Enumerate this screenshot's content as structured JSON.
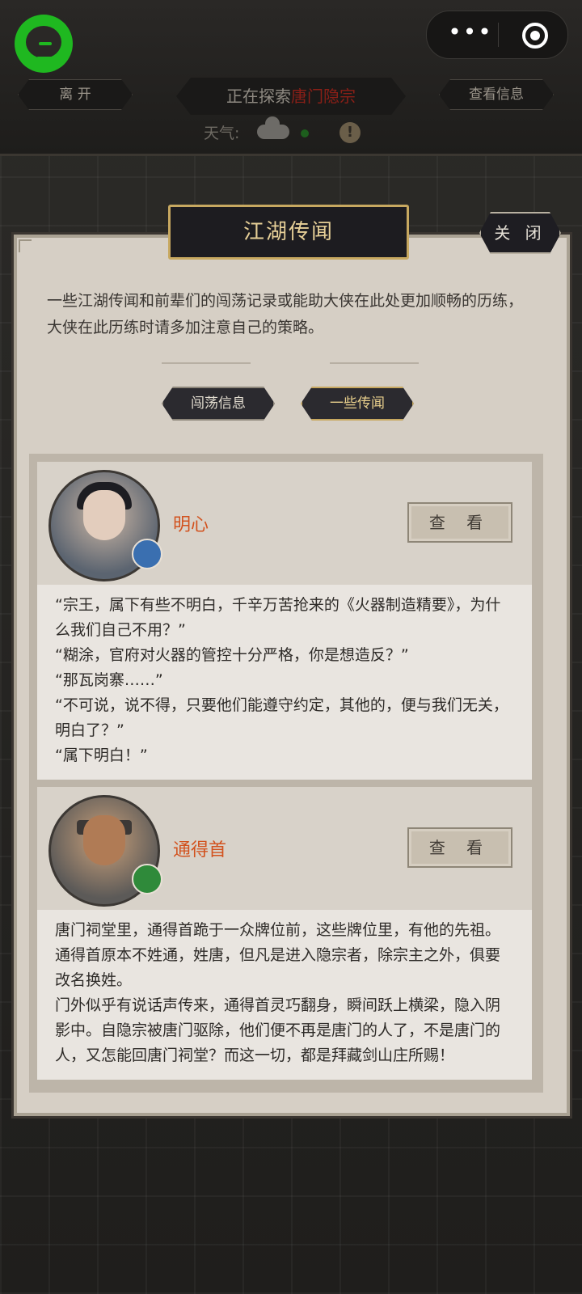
{
  "header": {
    "leave_label": "离 开",
    "explore_prefix": "正在探索",
    "explore_location": "唐门隐宗",
    "info_label": "查看信息",
    "weather_label": "天气:"
  },
  "dialog": {
    "title": "江湖传闻",
    "close_label": "关 闭",
    "intro": "一些江湖传闻和前辈们的闯荡记录或能助大侠在此处更加顺畅的历练，大侠在此历练时请多加注意自己的策略。",
    "tabs": [
      {
        "label": "闯荡信息",
        "active": false
      },
      {
        "label": "一些传闻",
        "active": true
      }
    ],
    "cards": [
      {
        "name": "明心",
        "view_label": "查 看",
        "lines": [
          "“宗王，属下有些不明白，千辛万苦抢来的《火器制造精要》，为什么我们自己不用？”",
          "“糊涂，官府对火器的管控十分严格，你是想造反？”",
          "“那瓦岗寨……”",
          "“不可说，说不得，只要他们能遵守约定，其他的，便与我们无关，明白了？”",
          "“属下明白！”"
        ]
      },
      {
        "name": "通得首",
        "view_label": "查 看",
        "lines": [
          "唐门祠堂里，通得首跪于一众牌位前，这些牌位里，有他的先祖。通得首原本不姓通，姓唐，但凡是进入隐宗者，除宗主之外，俱要改名换姓。",
          "门外似乎有说话声传来，通得首灵巧翻身，瞬间跃上横梁，隐入阴影中。自隐宗被唐门驱除，他们便不再是唐门的人了，不是唐门的人，又怎能回唐门祠堂？而这一切，都是拜藏剑山庄所赐！"
        ]
      }
    ]
  },
  "colors": {
    "accent_gold": "#c7a860",
    "name_orange": "#d2521e",
    "location_red": "#8a1f17",
    "logo_green": "#1fb820"
  }
}
